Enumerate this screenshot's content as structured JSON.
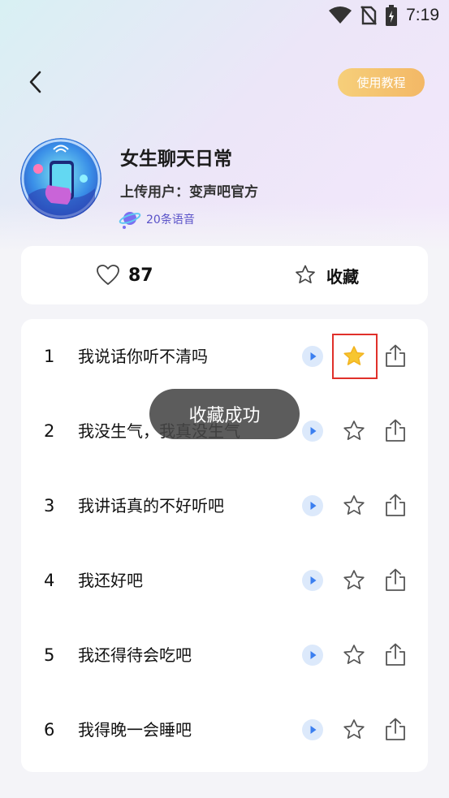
{
  "status_bar": {
    "time": "7:19",
    "icons": [
      "wifi-icon",
      "no-sim-icon",
      "battery-charging-icon"
    ]
  },
  "header": {
    "back_icon": "chevron-left-icon",
    "tutorial_button": "使用教程"
  },
  "pack": {
    "title": "女生聊天日常",
    "uploader": "上传用户：变声吧官方",
    "voice_count": "20条语音"
  },
  "stats": {
    "like_count": "87",
    "favorite_label": "收藏"
  },
  "voices": [
    {
      "index": "1",
      "text": "我说话你听不清吗",
      "favorited": true
    },
    {
      "index": "2",
      "text": "我没生气，我真没生气",
      "favorited": false
    },
    {
      "index": "3",
      "text": "我讲话真的不好听吧",
      "favorited": false
    },
    {
      "index": "4",
      "text": "我还好吧",
      "favorited": false
    },
    {
      "index": "5",
      "text": "我还得待会吃吧",
      "favorited": false
    },
    {
      "index": "6",
      "text": "我得晚一会睡吧",
      "favorited": false
    }
  ],
  "toast": "收藏成功",
  "colors": {
    "accent": "#f3b866",
    "star_active": "#f7c630",
    "play_bg": "#dce9fb",
    "play_icon": "#3b7ff0",
    "highlight": "#e0302a"
  }
}
